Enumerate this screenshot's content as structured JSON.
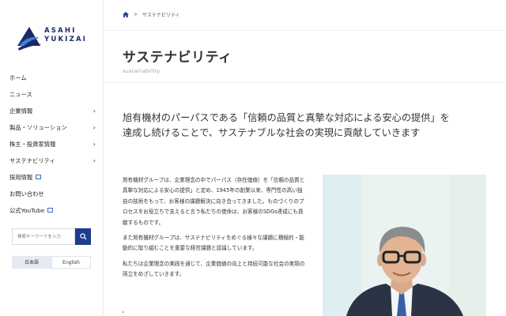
{
  "brand": {
    "line1": "ASAHI",
    "line2": "YUKIZAI"
  },
  "sidebar": {
    "items": [
      {
        "label": "ホーム",
        "chevron": false,
        "external": false
      },
      {
        "label": "ニュース",
        "chevron": false,
        "external": false
      },
      {
        "label": "企業情報",
        "chevron": true,
        "external": false
      },
      {
        "label": "製品・ソリューション",
        "chevron": true,
        "external": false
      },
      {
        "label": "株主・投資家情報",
        "chevron": true,
        "external": false
      },
      {
        "label": "サステナビリティ",
        "chevron": true,
        "external": false
      },
      {
        "label": "採用情報",
        "chevron": false,
        "external": true
      },
      {
        "label": "お問い合わせ",
        "chevron": false,
        "external": false
      },
      {
        "label": "公式YouTube",
        "chevron": false,
        "external": true
      }
    ],
    "search": {
      "placeholder": "検索キーワードを入力"
    },
    "languages": [
      {
        "label": "日本語",
        "active": true
      },
      {
        "label": "English",
        "active": false
      }
    ]
  },
  "breadcrumb": {
    "home_icon": "home-icon",
    "separator": ">",
    "current": "サステナビリティ"
  },
  "page": {
    "title": "サステナビリティ",
    "subtitle": "sustainability",
    "lead": "旭有機材のパーパスである「信頼の品質と真摯な対応による安心の提供」を\n達成し続けることで、サステナブルな社会の実現に貢献していきます",
    "paragraphs": [
      "旭有機材グループは、企業理念の中でパーパス（存在価値）を「信頼の品質と真摯な対応による安心の提供」と定め、1945年の創業以来、専門性の高い独自の技術をもって、お客様の課題解決に向き合ってきました。ものづくりのプロセスをお役立ちで支えると言う私たちの使命は、お客様のSDGs達成にも貢献するものです。",
      "また旭有機材グループは、サステナビリティをめぐる様々な課題に積極的・能動的に取り組むことを重要な経営課題と認識しています。",
      "私たちは企業理念の実践を通じて、企業価値の向上と持続可能な社会の実現の両立をめざしていきます。"
    ]
  },
  "colors": {
    "brand_navy": "#1a2a66",
    "accent_blue": "#1d3c8f"
  }
}
